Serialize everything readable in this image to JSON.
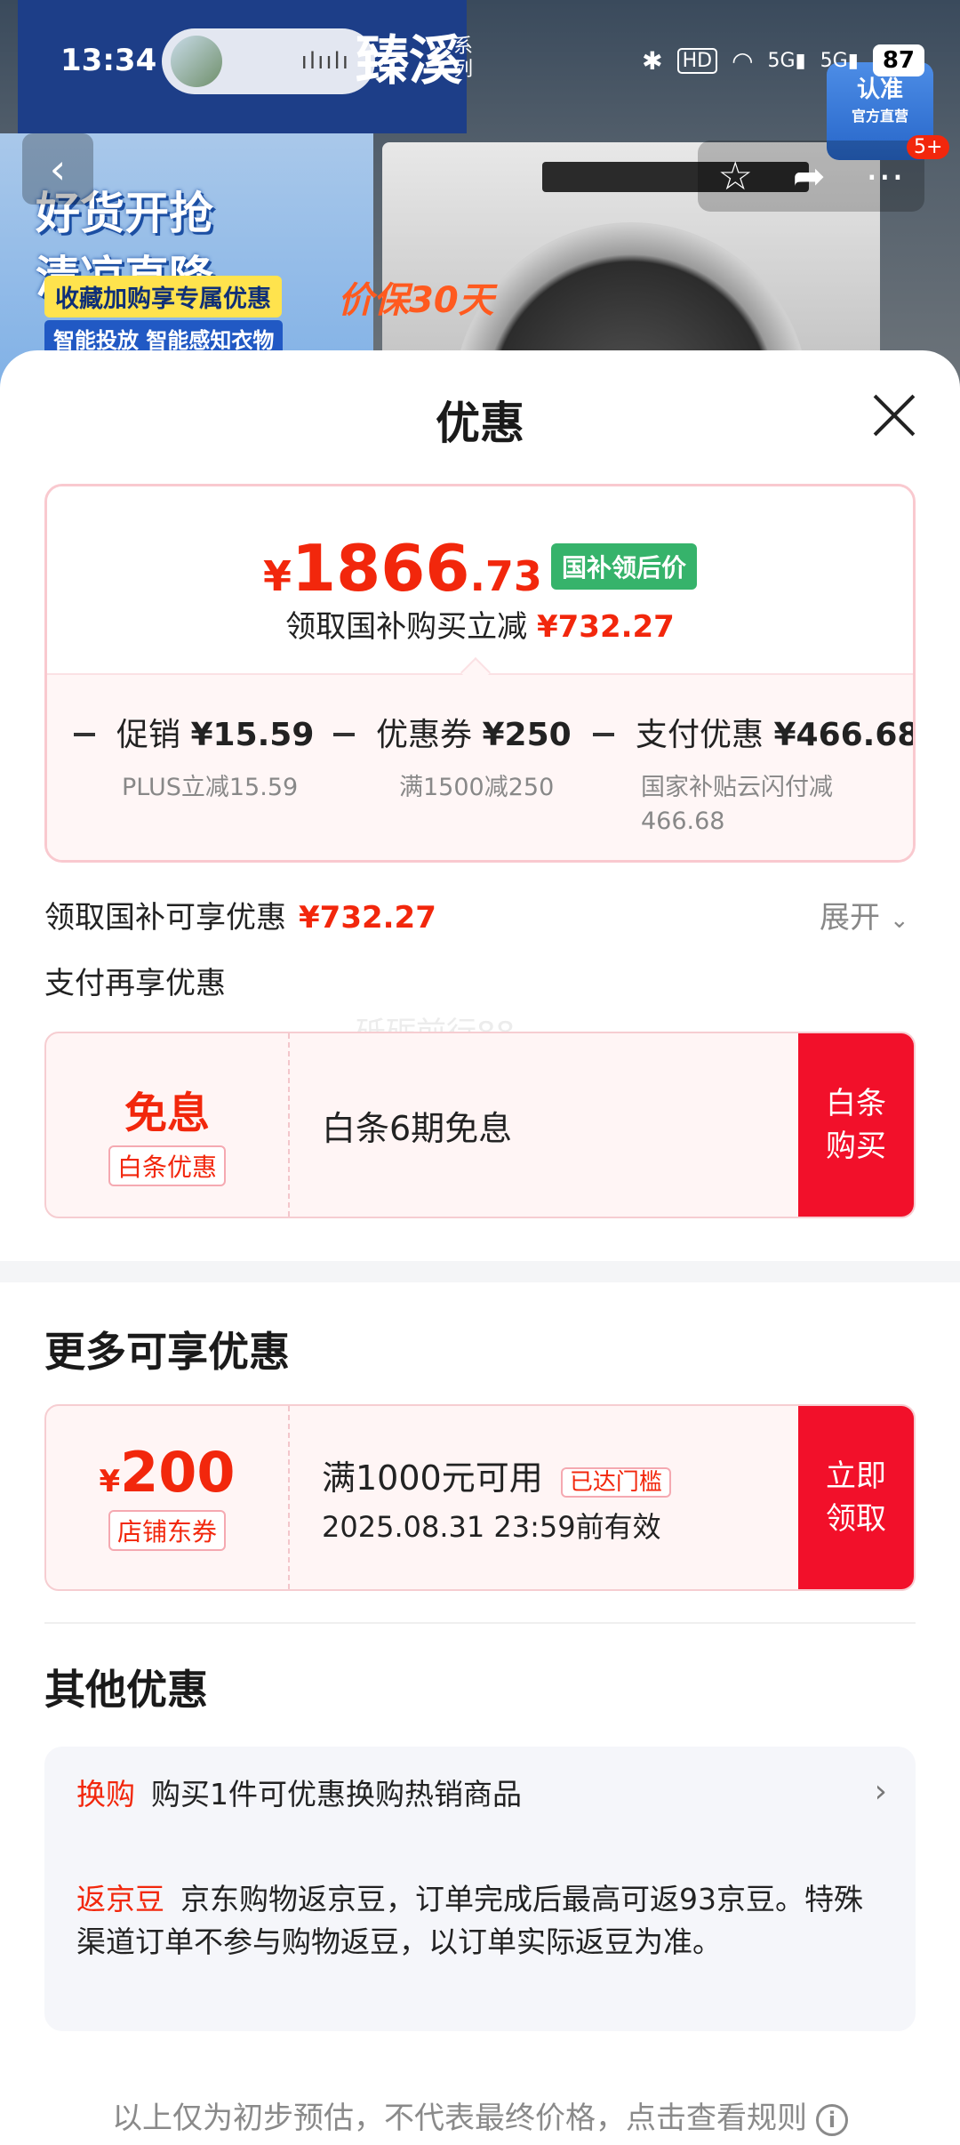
{
  "status_bar": {
    "time": "13:34",
    "battery": "87",
    "network": "5G",
    "hd": "HD"
  },
  "background": {
    "brand_series": "系列",
    "brand_name": "臻溪",
    "promo_line1": "好货开抢",
    "promo_line2": "清凉直降",
    "promo_strip": "收藏加购享专属优惠",
    "promo_features": "智能投放 智能感知衣物",
    "price_protect": "价保30天",
    "auth_badge": "认准",
    "auth_badge_sub": "官方直营",
    "more_badge": "5+"
  },
  "sheet": {
    "title": "优惠",
    "price_card": {
      "currency": "¥",
      "price_int": "1866",
      "price_dec": ".73",
      "price_tag": "国补领后价",
      "subsidy_text": "领取国补购买立减",
      "subsidy_amount": "¥732.27",
      "breakdown": [
        {
          "label": "促销",
          "amount": "¥15.59",
          "desc": "PLUS立减15.59"
        },
        {
          "label": "优惠券",
          "amount": "¥250",
          "desc": "满1500减250"
        },
        {
          "label": "支付优惠",
          "amount": "¥466.68",
          "desc": "国家补贴云闪付减\n466.68"
        }
      ]
    },
    "subsidy_row": {
      "label": "领取国补可享优惠",
      "amount": "¥732.27",
      "expand": "展开"
    },
    "pay_more_label": "支付再享优惠",
    "watermark": "砥砺前行88",
    "baitiao_card": {
      "big": "免息",
      "tag": "白条优惠",
      "text": "白条6期免息",
      "button": "白条\n购买"
    },
    "more_title": "更多可享优惠",
    "coupon_card": {
      "currency": "¥",
      "amount": "200",
      "tag": "店铺东券",
      "condition": "满1000元可用",
      "reached": "已达门槛",
      "validity": "2025.08.31 23:59前有效",
      "button": "立即\n领取"
    },
    "other_title": "其他优惠",
    "other_items": [
      {
        "tag": "换购",
        "text": "购买1件可优惠换购热销商品"
      },
      {
        "tag": "返京豆",
        "text": "京东购物返京豆，订单完成后最高可返93京豆。特殊渠道订单不参与购物返豆，以订单实际返豆为准。"
      }
    ],
    "footer": "以上仅为初步预估，不代表最终价格，点击查看规则"
  },
  "colors": {
    "accent_red": "#f2270c",
    "button_red": "#f2102a",
    "green_tag": "#36b36b"
  }
}
